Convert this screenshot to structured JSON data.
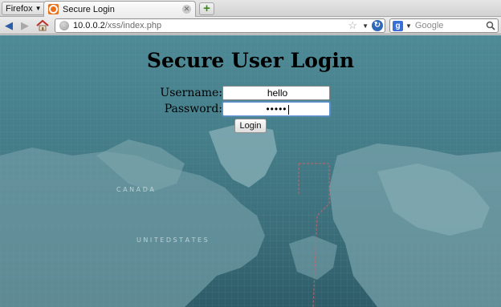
{
  "browser": {
    "menu_label": "Firefox",
    "tab_title": "Secure Login",
    "url_host": "10.0.0.2",
    "url_path": "/xss/index.php",
    "search_placeholder": "Google"
  },
  "page": {
    "title": "Secure User Login",
    "username_label": "Username:",
    "username_value": "hello",
    "password_label": "Password:",
    "password_mask": "•••••",
    "login_button": "Login"
  },
  "map_labels": {
    "canada": "C A N A D A",
    "united_states": "U N I T E D   S T A T E S"
  },
  "icons": [
    "firefox-menu-chevron-icon",
    "tab-favicon-icon",
    "tab-close-icon",
    "new-tab-icon",
    "back-icon",
    "forward-icon",
    "home-icon",
    "site-identity-icon",
    "bookmark-star-icon",
    "url-history-icon",
    "reload-icon",
    "search-engine-icon",
    "search-go-icon"
  ],
  "colors": {
    "page_background": "#467f8b",
    "accent": "#2f69b8"
  }
}
